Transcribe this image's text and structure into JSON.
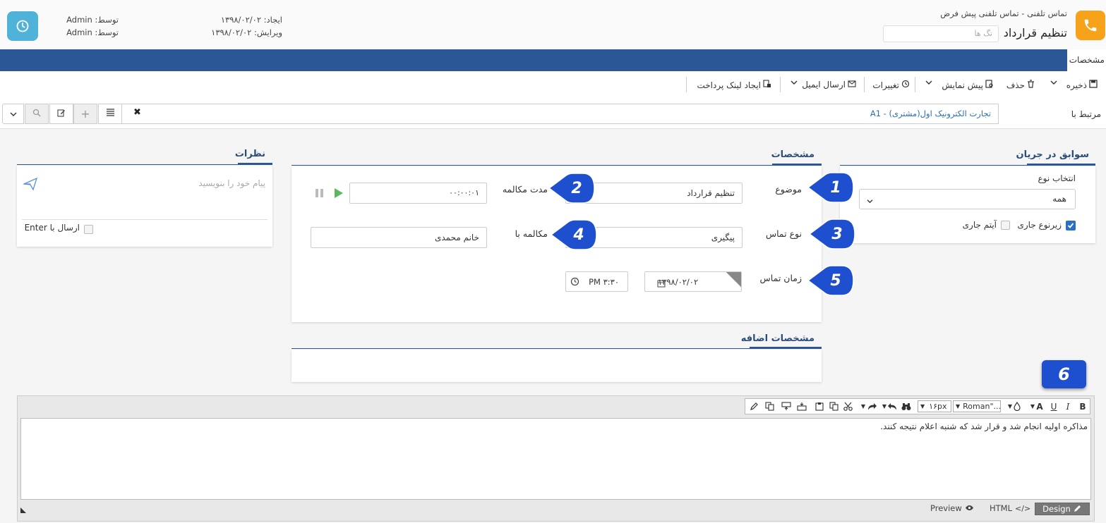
{
  "header": {
    "breadcrumb_type": "تماس تلفنی -",
    "breadcrumb_sub": "تماس تلفنی پیش فرض",
    "title": "تنظیم قرارداد",
    "tags_placeholder": "تگ ها",
    "created_label": "ایجاد: ۱۳۹۸/۰۲/۰۲",
    "edited_label": "ویرایش: ۱۳۹۸/۰۲/۰۲",
    "created_by": "توسط: Admin",
    "edited_by": "توسط: Admin"
  },
  "tabs": {
    "spec": "مشخصات"
  },
  "toolbar": {
    "save": "ذخیره",
    "delete": "حذف",
    "preview": "پیش نمایش",
    "changes": "تغییرات",
    "send_email": "ارسال ایمیل",
    "payment_link": "ایجاد لینک پرداخت"
  },
  "related": {
    "label": "مرتبط با",
    "value": "تجارت الکترونیک اول(مشتری) - A1"
  },
  "history_panel": {
    "title": "سوابق در جریان",
    "type_label": "انتخاب نوع",
    "type_value": "همه",
    "subtype_label": "زیرنوع جاری",
    "current_item_label": "آیتم جاری",
    "subtype_checked": true,
    "current_item_checked": false
  },
  "spec_panel": {
    "title": "مشخصات",
    "subject_label": "موضوع",
    "subject_value": "تنظیم قرارداد",
    "duration_label": "مدت مکالمه",
    "duration_value": "۰۰:۰۰:۰۱",
    "call_type_label": "نوع تماس",
    "call_type_value": "پیگیری",
    "talk_with_label": "مکالمه با",
    "talk_with_value": "خانم محمدی",
    "call_time_label": "زمان تماس",
    "call_date_value": "۱۳۹۸/۰۲/۰۲",
    "call_time_value": "PM ۳:۳۰"
  },
  "extra_panel": {
    "title": "مشخصات اضافه"
  },
  "comments_panel": {
    "title": "نظرات",
    "placeholder": "پیام خود را بنویسید",
    "send_enter_label": "ارسال با Enter"
  },
  "badges": {
    "b1": "1",
    "b2": "2",
    "b3": "3",
    "b4": "4",
    "b5": "5",
    "b6": "6"
  },
  "editor": {
    "font_name": "Roman\"...",
    "font_size": "۱۶px",
    "body_text": "مذاکره اولیه انجام شد و قرار شد که شنبه اعلام نتیجه کنند.",
    "design_label": "Design",
    "html_label": "HTML",
    "preview_label": "Preview",
    "bold": "B",
    "italic": "I",
    "underline": "U",
    "font_color": "A"
  },
  "colors": {
    "accent_blue": "#2b5797",
    "badge_blue": "#1d4fcf",
    "phone_orange": "#f7a21b",
    "clock_teal": "#4fb3d9",
    "play_green": "#5cb85c"
  }
}
